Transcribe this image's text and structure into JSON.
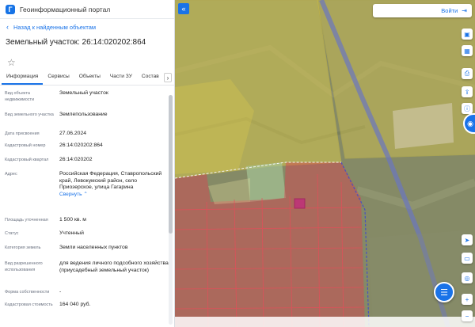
{
  "app": {
    "logo_letter": "Г",
    "title": "Геоинформационный портал"
  },
  "nav": {
    "back_label": "Назад к найденным объектам"
  },
  "parcel": {
    "title": "Земельный участок: 26:14:020202:864"
  },
  "tabs": [
    "Информация",
    "Сервисы",
    "Объекты",
    "Части ЗУ",
    "Состав"
  ],
  "properties": [
    {
      "key": "Вид объекта недвижимости",
      "value": "Земельный участок"
    },
    {
      "key": "Вид земельного участка",
      "value": "Землепользование"
    },
    {
      "key": "Дата присвоения",
      "value": "27.06.2024"
    },
    {
      "key": "Кадастровый номер",
      "value": "26:14:020202:864"
    },
    {
      "key": "Кадастровый квартал",
      "value": "26:14:020202"
    },
    {
      "key": "Адрес",
      "value": "Российская Федерация, Ставропольский край, Левокумский район, село Приозерское, улица Гагарина",
      "link": "Свернуть"
    },
    {
      "key": "Площадь уточненная",
      "value": "1 500 кв. м"
    },
    {
      "key": "Статус",
      "value": "Учтенный"
    },
    {
      "key": "Категория земель",
      "value": "Земли населенных пунктов"
    },
    {
      "key": "Вид разрешенного использования",
      "value": "для ведения личного подсобного хозяйства (приусадебный земельный участок)"
    },
    {
      "key": "Форма собственности",
      "value": "-"
    },
    {
      "key": "Кадастровая стоимость",
      "value": "164 040 руб."
    }
  ],
  "map": {
    "login_label": "Войти",
    "collapse_icon": "double-chevron-left-icon",
    "right_buttons": [
      "layers-icon",
      "grid-icon",
      "print-icon",
      "share-icon",
      "info-icon",
      "navigation-icon",
      "measure-icon",
      "compass-icon",
      "zoom-in-icon",
      "zoom-out-icon"
    ],
    "colors": {
      "accent": "#1a73e8",
      "yellow_zone": "#e6d34a",
      "red_zone": "#e0394a"
    }
  }
}
